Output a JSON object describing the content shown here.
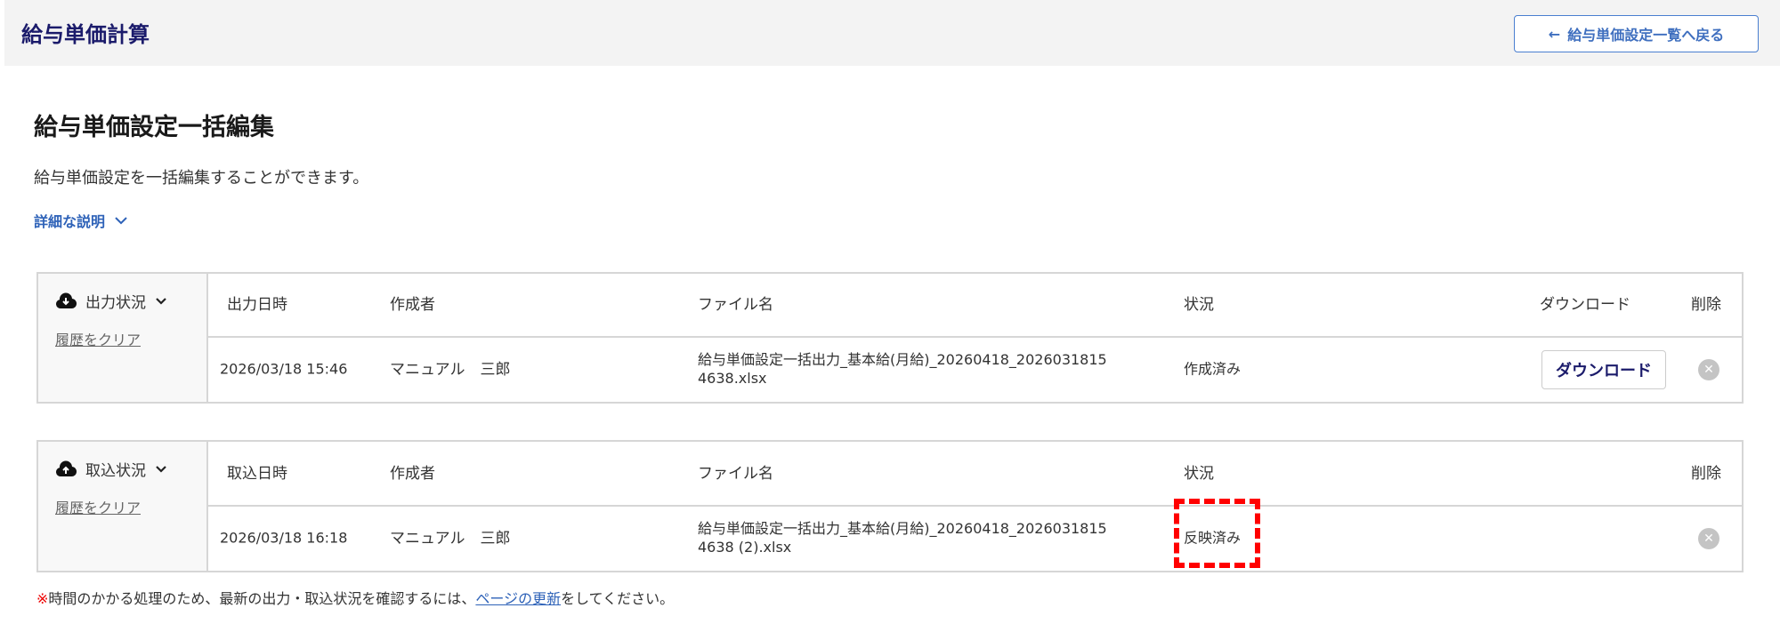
{
  "header": {
    "title": "給与単価計算",
    "back_label": "給与単価設定一覧へ戻る"
  },
  "page": {
    "title": "給与単価設定一括編集",
    "description": "給与単価設定を一括編集することができます。",
    "details_label": "詳細な説明"
  },
  "export": {
    "title": "出力状況",
    "clear_label": "履歴をクリア",
    "columns": [
      "出力日時",
      "作成者",
      "ファイル名",
      "状況",
      "ダウンロード",
      "削除"
    ],
    "rows": [
      {
        "datetime": "2026/03/18 15:46",
        "author": "マニュアル　三郎",
        "file_line1": "給与単価設定一括出力_基本給(月給)_20260418_2026031815",
        "file_line2": "4638.xlsx",
        "status": "作成済み",
        "download_label": "ダウンロード"
      }
    ]
  },
  "import": {
    "title": "取込状況",
    "clear_label": "履歴をクリア",
    "columns": [
      "取込日時",
      "作成者",
      "ファイル名",
      "状況",
      "削除"
    ],
    "rows": [
      {
        "datetime": "2026/03/18 16:18",
        "author": "マニュアル　三郎",
        "file_line1": "給与単価設定一括出力_基本給(月給)_20260418_2026031815",
        "file_line2": "4638 (2).xlsx",
        "status": "反映済み"
      }
    ]
  },
  "note": {
    "mark": "※",
    "text1": "時間のかかる処理のため、最新の出力・取込状況を確認するには、",
    "link": "ページの更新",
    "text2": "をしてください。"
  },
  "colors": {
    "accent": "#2e62b8",
    "title": "#1b1b6b",
    "highlight": "#ff0000"
  }
}
